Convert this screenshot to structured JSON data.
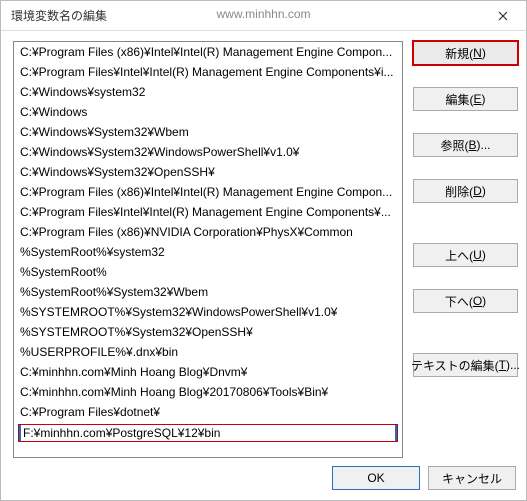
{
  "titlebar": {
    "title": "環境変数名の編集",
    "watermark": "www.minhhn.com"
  },
  "list": {
    "items": [
      "C:¥Program Files (x86)¥Intel¥Intel(R) Management Engine Compon...",
      "C:¥Program Files¥Intel¥Intel(R) Management Engine Components¥i...",
      "C:¥Windows¥system32",
      "C:¥Windows",
      "C:¥Windows¥System32¥Wbem",
      "C:¥Windows¥System32¥WindowsPowerShell¥v1.0¥",
      "C:¥Windows¥System32¥OpenSSH¥",
      "C:¥Program Files (x86)¥Intel¥Intel(R) Management Engine Compon...",
      "C:¥Program Files¥Intel¥Intel(R) Management Engine Components¥...",
      "C:¥Program Files (x86)¥NVIDIA Corporation¥PhysX¥Common",
      "%SystemRoot%¥system32",
      "%SystemRoot%",
      "%SystemRoot%¥System32¥Wbem",
      "%SYSTEMROOT%¥System32¥WindowsPowerShell¥v1.0¥",
      "%SYSTEMROOT%¥System32¥OpenSSH¥",
      "%USERPROFILE%¥.dnx¥bin",
      "C:¥minhhn.com¥Minh Hoang Blog¥Dnvm¥",
      "C:¥minhhn.com¥Minh Hoang Blog¥20170806¥Tools¥Bin¥",
      "C:¥Program Files¥dotnet¥"
    ],
    "edit_value": "F:¥minhhn.com¥PostgreSQL¥12¥bin"
  },
  "buttons": {
    "new_label": "新規(",
    "new_key": "N",
    "new_suffix": ")",
    "edit_label": "編集(",
    "edit_key": "E",
    "edit_suffix": ")",
    "browse_label": "参照(",
    "browse_key": "B",
    "browse_suffix": ")...",
    "delete_label": "削除(",
    "delete_key": "D",
    "delete_suffix": ")",
    "up_label": "上へ(",
    "up_key": "U",
    "up_suffix": ")",
    "down_label": "下へ(",
    "down_key": "O",
    "down_suffix": ")",
    "textedit_label": "テキストの編集(",
    "textedit_key": "T",
    "textedit_suffix": ")..."
  },
  "footer": {
    "ok": "OK",
    "cancel": "キャンセル"
  }
}
